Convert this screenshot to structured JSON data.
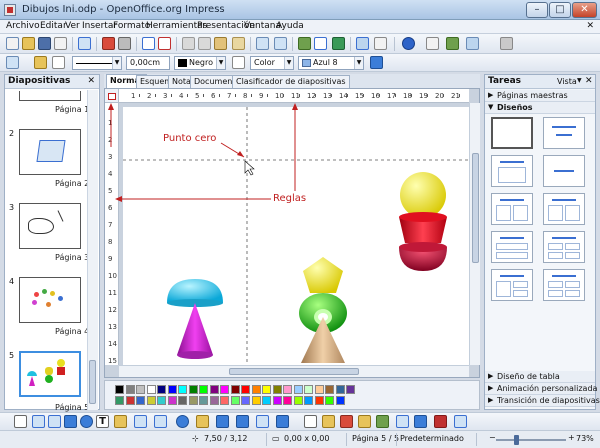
{
  "window": {
    "title": "Dibujos Ini.odp - OpenOffice.org Impress",
    "min": "–",
    "max": "□",
    "close": "✕"
  },
  "menu": {
    "items": [
      "Archivo",
      "Editar",
      "Ver",
      "Insertar",
      "Formato",
      "Herramientas",
      "Presentación",
      "Ventana",
      "Ayuda"
    ],
    "close": "✕"
  },
  "toolbar2": {
    "line_width": "0,00cm",
    "line_color": "Negro",
    "fill_type": "Color",
    "fill_color": "Azul 8"
  },
  "slides_panel": {
    "title": "Diapositivas",
    "close": "✕",
    "slides": [
      {
        "num": "",
        "label": "Página 1"
      },
      {
        "num": "2",
        "label": "Página 2"
      },
      {
        "num": "3",
        "label": "Página 3"
      },
      {
        "num": "4",
        "label": "Página 4"
      },
      {
        "num": "5",
        "label": "Página 5"
      }
    ]
  },
  "tabs": [
    "Normal",
    "Esquema",
    "Notas",
    "Documento",
    "Clasificador de diapositivas"
  ],
  "ruler": {
    "h_numbers": [
      "1",
      "2",
      "3",
      "4",
      "5",
      "6",
      "7",
      "8",
      "9",
      "10",
      "11",
      "12",
      "13",
      "14",
      "15",
      "16",
      "17",
      "18",
      "19",
      "20",
      "21"
    ],
    "v_numbers": [
      "1",
      "2",
      "3",
      "4",
      "5",
      "6",
      "7",
      "8",
      "9",
      "10",
      "11",
      "12",
      "13",
      "14",
      "15"
    ]
  },
  "annotations": {
    "origin": "Punto cero",
    "rulers": "Reglas"
  },
  "task_panel": {
    "title": "Tareas",
    "view": "Vista",
    "close": "✕",
    "sections": {
      "master": "Páginas maestras",
      "layouts": "Diseños",
      "table": "Diseño de tabla",
      "animation": "Animación personalizada",
      "transition": "Transición de diapositivas"
    }
  },
  "status": {
    "position": "7,50 / 3,12",
    "size": "0,00 x 0,00",
    "page": "Página 5 / 5",
    "style": "Predeterminado",
    "zoom": "73%"
  },
  "colors": {
    "palette": [
      "#000000",
      "#808080",
      "#c0c0c0",
      "#ffffff",
      "#000080",
      "#0000ff",
      "#00ffff",
      "#008000",
      "#00ff00",
      "#800080",
      "#ff00ff",
      "#800000",
      "#ff0000",
      "#ff8000",
      "#ffff00",
      "#808000",
      "#ff99cc",
      "#99ccff",
      "#ccffcc",
      "#ffcc99",
      "#996633",
      "#336699",
      "#663399",
      "#339966",
      "#cc3333",
      "#3366cc",
      "#cccc33",
      "#33cccc",
      "#cc33cc",
      "#666666",
      "#999966",
      "#669999",
      "#996699",
      "#ff6666",
      "#66ff66",
      "#6666ff",
      "#ffcc00",
      "#00ccff",
      "#cc00ff",
      "#ff0099",
      "#99ff00",
      "#0099ff",
      "#ff3300",
      "#33ff00",
      "#0033ff"
    ]
  }
}
